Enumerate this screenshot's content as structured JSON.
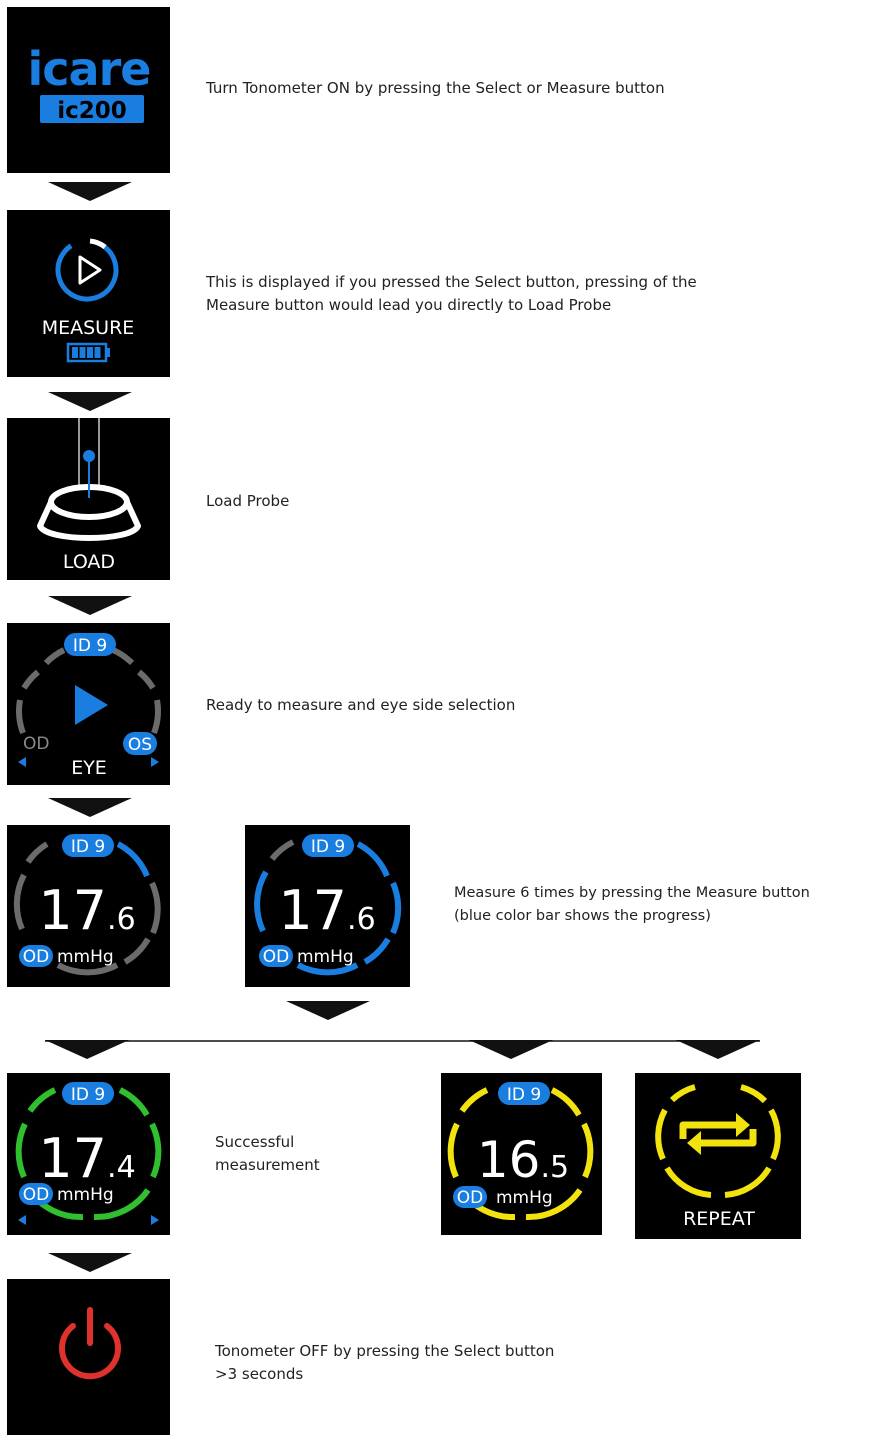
{
  "steps": {
    "power_on": {
      "brand": "icare",
      "model": "ic200",
      "description": "Turn Tonometer ON by pressing the Select or Measure button"
    },
    "measure_menu": {
      "label": "MEASURE",
      "description_line1": "This is displayed if you pressed the Select button, pressing of the",
      "description_line2": "Measure button would lead you directly to Load Probe"
    },
    "load_probe": {
      "label": "LOAD",
      "description": "Load Probe"
    },
    "ready": {
      "id_badge": "ID 9",
      "left_eye": "OD",
      "right_eye": "OS",
      "label": "EYE",
      "description": "Ready to measure and eye side selection"
    },
    "measuring": {
      "id_badge": "ID 9",
      "value_int": "17",
      "value_dec": ".6",
      "eye": "OD",
      "unit": "mmHg",
      "description_line1": "Measure 6 times by pressing the Measure button",
      "description_line2": "(blue color bar shows the progress)"
    },
    "success": {
      "id_badge": "ID 9",
      "value_int": "17",
      "value_dec": ".4",
      "eye": "OD",
      "unit": "mmHg",
      "description_line1": "Successful",
      "description_line2": "measurement"
    },
    "caution": {
      "id_badge": "ID 9",
      "value_int": "16",
      "value_dec": ".5",
      "eye": "OD",
      "unit": "mmHg"
    },
    "repeat": {
      "label": "REPEAT"
    },
    "power_off": {
      "description_line1": "Tonometer OFF by pressing the Select button",
      "description_line2": ">3 seconds"
    }
  },
  "colors": {
    "accent_blue": "#1a7ee0",
    "ring_grey": "#6b6b6b",
    "success_green": "#2fbf2f",
    "caution_yellow": "#f2e20e",
    "off_red": "#e0322c",
    "screen_bg": "#000000"
  },
  "icons": [
    "play-icon",
    "battery-icon",
    "probe-icon",
    "repeat-icon",
    "power-icon",
    "arrow-down-icon"
  ]
}
